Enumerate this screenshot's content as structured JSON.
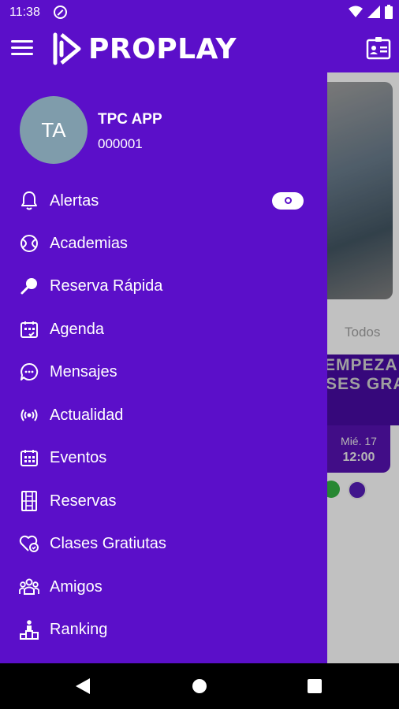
{
  "status_bar": {
    "time": "11:38",
    "icons": [
      "dnd-icon",
      "wifi-icon",
      "signal-icon",
      "battery-icon"
    ]
  },
  "app_bar": {
    "logo_text": "PROPLAY",
    "colors": {
      "primary": "#5b0fc9"
    }
  },
  "drawer": {
    "user": {
      "initials": "TA",
      "name": "TPC APP",
      "id": "000001"
    },
    "alerts_badge": "0",
    "items": [
      {
        "label": "Alertas",
        "icon": "bell-icon"
      },
      {
        "label": "Academias",
        "icon": "tennis-ball-icon"
      },
      {
        "label": "Reserva Rápida",
        "icon": "racket-icon"
      },
      {
        "label": "Agenda",
        "icon": "calendar-check-icon"
      },
      {
        "label": "Mensajes",
        "icon": "chat-bubble-icon"
      },
      {
        "label": "Actualidad",
        "icon": "broadcast-icon"
      },
      {
        "label": "Eventos",
        "icon": "calendar-grid-icon"
      },
      {
        "label": "Reservas",
        "icon": "court-icon"
      },
      {
        "label": "Clases Gratiutas",
        "icon": "heart-check-icon"
      },
      {
        "label": "Amigos",
        "icon": "group-icon"
      },
      {
        "label": "Ranking",
        "icon": "podium-icon"
      }
    ]
  },
  "background": {
    "tab_label": "Todos",
    "banner_line1": "EMPEZA",
    "banner_line2": "SES GRA",
    "date_day": "Mié. 17",
    "date_time": "12:00"
  }
}
